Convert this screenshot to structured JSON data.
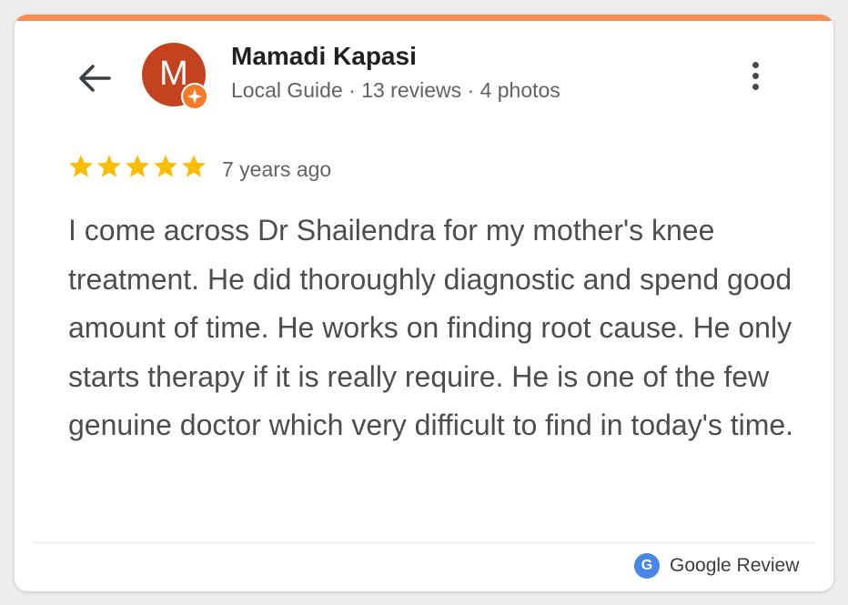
{
  "colors": {
    "accent_bar": "#fb8c55",
    "avatar_bg": "#c5421e",
    "guide_badge": "#f47b2a",
    "star": "#fbbc04",
    "google_badge": "#4a86e8"
  },
  "header": {
    "back_icon": "arrow-left-icon",
    "avatar_letter": "M",
    "reviewer_name": "Mamadi Kapasi",
    "reviewer_meta": "Local Guide · 13 reviews · 4 photos",
    "more_icon": "more-vert-icon"
  },
  "review": {
    "rating": 5,
    "rating_max": 5,
    "age": "7 years ago",
    "text": "I come across Dr Shailendra for my mother's knee treatment. He did thoroughly diagnostic and spend good amount of time. He works on finding root cause. He only starts therapy if it is really require. He is one of the few genuine doctor which very difficult to find in today's time."
  },
  "footer": {
    "icon_letter": "G",
    "label": "Google Review"
  }
}
